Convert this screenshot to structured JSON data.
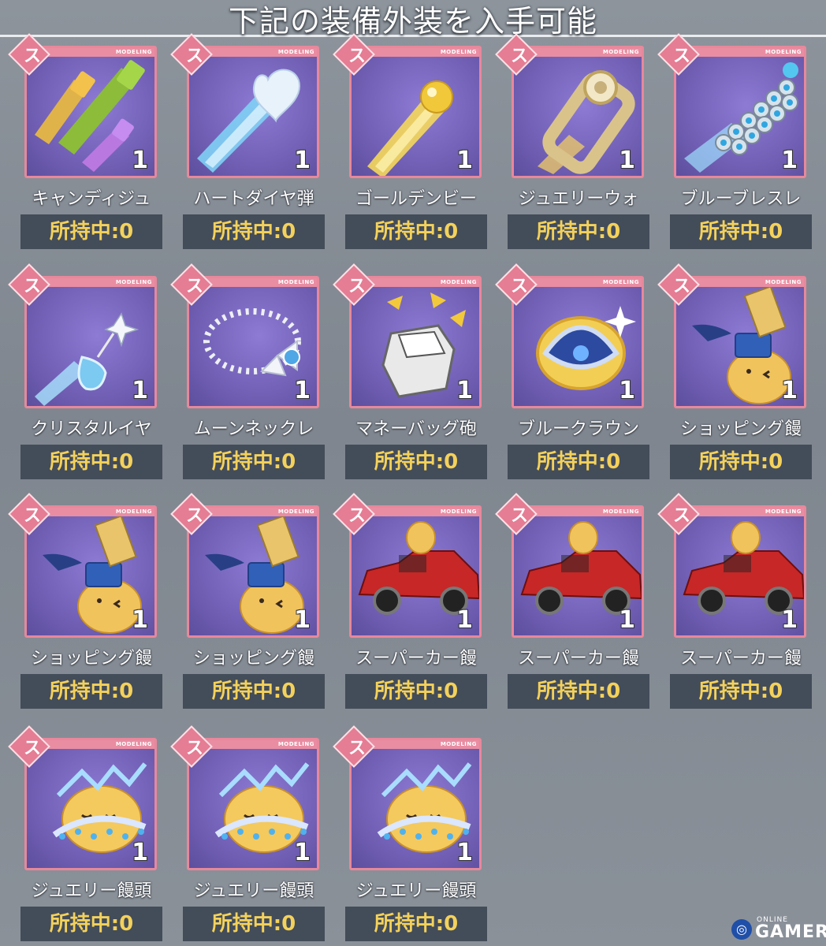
{
  "header": {
    "title": "下記の装備外装を入手可能"
  },
  "card": {
    "badge": "MODELING",
    "rank_glyph": "ス"
  },
  "items": [
    {
      "name": "キャンディジュ",
      "count": "1",
      "owned": "所持中:0",
      "art": "candy"
    },
    {
      "name": "ハートダイヤ弾",
      "count": "1",
      "owned": "所持中:0",
      "art": "heart"
    },
    {
      "name": "ゴールデンビー",
      "count": "1",
      "owned": "所持中:0",
      "art": "golden"
    },
    {
      "name": "ジュエリーウォ",
      "count": "1",
      "owned": "所持中:0",
      "art": "watch"
    },
    {
      "name": "ブルーブレスレ",
      "count": "1",
      "owned": "所持中:0",
      "art": "bracelet"
    },
    {
      "name": "クリスタルイヤ",
      "count": "1",
      "owned": "所持中:0",
      "art": "earring"
    },
    {
      "name": "ムーンネックレ",
      "count": "1",
      "owned": "所持中:0",
      "art": "necklace"
    },
    {
      "name": "マネーバッグ砲",
      "count": "1",
      "owned": "所持中:0",
      "art": "moneybag"
    },
    {
      "name": "ブルークラウン",
      "count": "1",
      "owned": "所持中:0",
      "art": "crown"
    },
    {
      "name": "ショッピング饅",
      "count": "1",
      "owned": "所持中:0",
      "art": "shopping"
    },
    {
      "name": "ショッピング饅",
      "count": "1",
      "owned": "所持中:0",
      "art": "shopping"
    },
    {
      "name": "ショッピング饅",
      "count": "1",
      "owned": "所持中:0",
      "art": "shopping"
    },
    {
      "name": "スーパーカー饅",
      "count": "1",
      "owned": "所持中:0",
      "art": "car"
    },
    {
      "name": "スーパーカー饅",
      "count": "1",
      "owned": "所持中:0",
      "art": "car"
    },
    {
      "name": "スーパーカー饅",
      "count": "1",
      "owned": "所持中:0",
      "art": "car"
    },
    {
      "name": "ジュエリー饅頭",
      "count": "1",
      "owned": "所持中:0",
      "art": "jewelry"
    },
    {
      "name": "ジュエリー饅頭",
      "count": "1",
      "owned": "所持中:0",
      "art": "jewelry"
    },
    {
      "name": "ジュエリー饅頭",
      "count": "1",
      "owned": "所持中:0",
      "art": "jewelry"
    }
  ],
  "watermark": {
    "small": "ONLINE",
    "big": "GAMER"
  },
  "colors": {
    "owned_text": "#f3d15b",
    "card_border": "#e7889c",
    "owned_bg": "#434c59"
  }
}
